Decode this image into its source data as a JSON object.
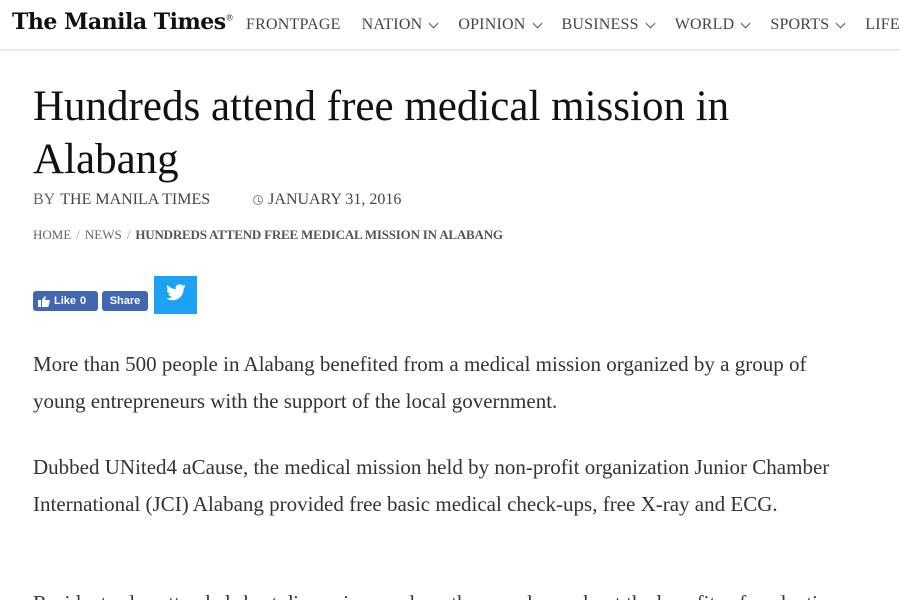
{
  "site": {
    "logo": "The Manila Times",
    "logo_mark": "®"
  },
  "nav": {
    "items": [
      {
        "label": "FRONTPAGE",
        "has_dropdown": false
      },
      {
        "label": "NATION",
        "has_dropdown": true
      },
      {
        "label": "OPINION",
        "has_dropdown": true
      },
      {
        "label": "BUSINESS",
        "has_dropdown": true
      },
      {
        "label": "WORLD",
        "has_dropdown": true
      },
      {
        "label": "SPORTS",
        "has_dropdown": true
      },
      {
        "label": "LIFE",
        "has_dropdown": false
      }
    ]
  },
  "article": {
    "headline": "Hundreds attend free medical mission in Alabang",
    "byline_prefix": "BY",
    "author": "THE MANILA TIMES",
    "date": "JANUARY 31, 2016",
    "breadcrumb": {
      "home": "HOME",
      "section": "NEWS",
      "current": "HUNDREDS ATTEND FREE MEDICAL MISSION IN ALABANG"
    },
    "share": {
      "like_label": "Like",
      "like_count": "0",
      "share_label": "Share"
    },
    "paragraphs": [
      "More than 500 people in Alabang benefited from a medical mission organized by a group of young entrepreneurs with the support of the local government.",
      "Dubbed UNited4 aCause, the medical mission held by non-profit organization Junior Chamber International (JCI) Alabang provided free basic medical check-ups, free X-ray and ECG.",
      "Residents also attended short discussions on how they can learn about the benefits of evaluation."
    ]
  },
  "colors": {
    "facebook": "#4267b2",
    "twitter": "#1da1f2",
    "headline": "#111111",
    "body_text": "#333333"
  },
  "icons": {
    "dropdown": "chevron-down-icon",
    "date": "clock-icon",
    "like": "thumbs-up-icon",
    "twitter": "twitter-bird-icon"
  }
}
